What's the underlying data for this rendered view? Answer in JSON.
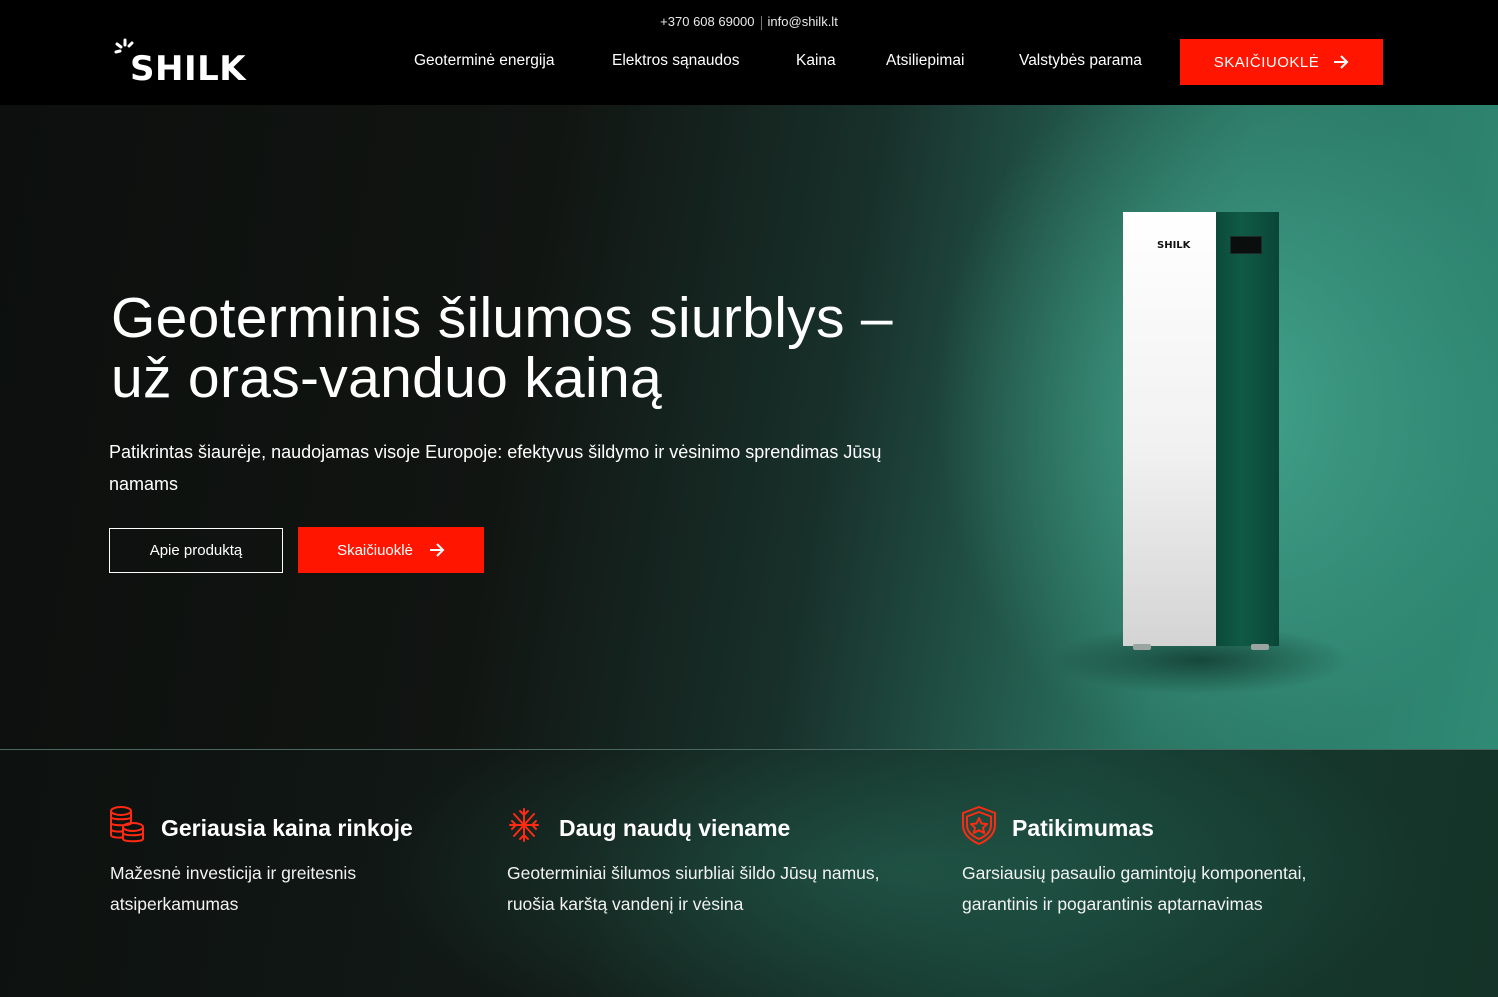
{
  "header": {
    "phone": "+370 608 69000",
    "email": "info@shilk.lt",
    "logo": "SHILK",
    "nav": [
      {
        "label": "Geoterminė energija"
      },
      {
        "label": "Elektros sąnaudos"
      },
      {
        "label": "Kaina"
      },
      {
        "label": "Atsiliepimai"
      },
      {
        "label": "Valstybės parama"
      }
    ],
    "cta_label": "SKAIČIUOKLĖ"
  },
  "hero": {
    "title_line1": "Geoterminis šilumos siurblys –",
    "title_line2": "už oras-vanduo kainą",
    "subtitle": "Patikrintas šiaurėje, naudojamas visoje Europoje: efektyvus šildymo ir vėsinimo sprendimas Jūsų namams",
    "btn_outline_label": "Apie produktą",
    "btn_red_label": "Skaičiuoklė",
    "product_logo": "SHILK"
  },
  "features": [
    {
      "icon": "coins-stack-icon",
      "title": "Geriausia kaina rinkoje",
      "text": "Mažesnė investicija ir greitesnis atsiperkamumas"
    },
    {
      "icon": "sun-snowflake-icon",
      "title": "Daug naudų viename",
      "text": "Geoterminiai šilumos siurbliai šildo Jūsų namus, ruošia karštą vandenį ir vėsina"
    },
    {
      "icon": "shield-star-icon",
      "title": "Patikimumas",
      "text": "Garsiausių pasaulio gamintojų komponentai, garantinis ir pogarantinis aptarnavimas"
    }
  ],
  "colors": {
    "accent": "#ff1500",
    "background": "#000000",
    "hero_teal": "#2f8a74"
  }
}
